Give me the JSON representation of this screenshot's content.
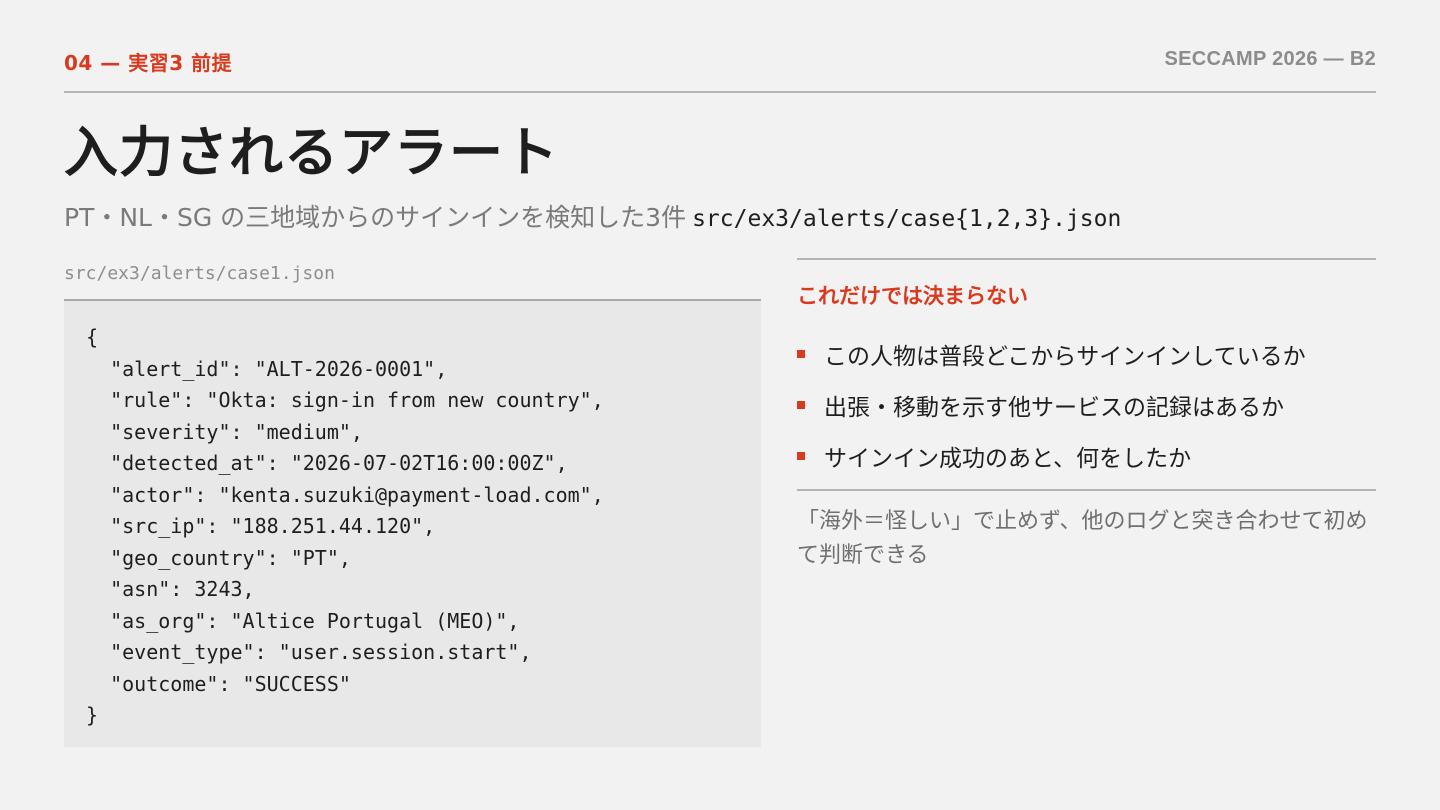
{
  "header": {
    "kicker": "04 — 実習3 前提",
    "deck_id": "SECCAMP 2026 — B2"
  },
  "title": "入力されるアラート",
  "subtitle": {
    "text": "PT・NL・SG の三地域からのサインインを検知した3件",
    "path": "src/ex3/alerts/case{1,2,3}.json"
  },
  "code_panel": {
    "file_label": "src/ex3/alerts/case1.json",
    "lines": [
      "{",
      "  \"alert_id\": \"ALT-2026-0001\",",
      "  \"rule\": \"Okta: sign-in from new country\",",
      "  \"severity\": \"medium\",",
      "  \"detected_at\": \"2026-07-02T16:00:00Z\",",
      "  \"actor\": \"kenta.suzuki@payment-load.com\",",
      "  \"src_ip\": \"188.251.44.120\",",
      "  \"geo_country\": \"PT\",",
      "  \"asn\": 3243,",
      "  \"as_org\": \"Altice Portugal (MEO)\",",
      "  \"event_type\": \"user.session.start\",",
      "  \"outcome\": \"SUCCESS\"",
      "}"
    ]
  },
  "right_panel": {
    "heading": "これだけでは決まらない",
    "bullets": [
      "この人物は普段どこからサインインしているか",
      "出張・移動を示す他サービスの記録はあるか",
      "サインイン成功のあと、何をしたか"
    ],
    "note": "「海外＝怪しい」で止めず、他のログと突き合わせて初めて判断できる"
  },
  "colors": {
    "accent": "#d93a1f",
    "background": "#f2f2f2",
    "code_background": "#e8e8e8",
    "muted_text": "#8c8c8c"
  }
}
